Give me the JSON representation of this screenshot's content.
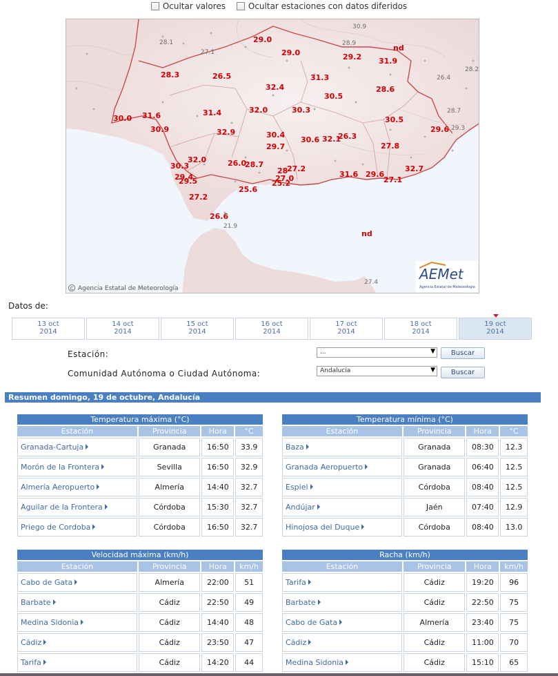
{
  "options": {
    "hide_values": "Ocultar valores",
    "hide_deferred": "Ocultar estaciones con datos diferidos"
  },
  "map": {
    "copyright": "Agencia Estatal de Meteorología",
    "logo_text": "AEMet",
    "logo_sub": "Agencia Estatal de Meteorología",
    "labels_red": [
      "29.0",
      "29.0",
      "29.2",
      "nd",
      "31.9",
      "28.3",
      "26.5",
      "31.3",
      "32.4",
      "30.5",
      "28.6",
      "31.6",
      "31.4",
      "32.0",
      "30.3",
      "30.0",
      "30.9",
      "32.9",
      "30.4",
      "30.6",
      "32.1",
      "26.3",
      "30.5",
      "29.6",
      "29.7",
      "27.8",
      "32.0",
      "26.0",
      "28.7",
      "27.2",
      "30.3",
      "28",
      "29.4",
      "29.5",
      "25.6",
      "25.2",
      "27.0",
      "31.6",
      "29.6",
      "27.1",
      "32.7",
      "27.2",
      "26.6",
      "nd"
    ],
    "labels_grey": [
      "30.9",
      "28.1",
      "27.1",
      "28.9",
      "26.4",
      "28.2",
      "28.7",
      "29.3",
      "21.9",
      "27.4"
    ]
  },
  "datos_label": "Datos de:",
  "dates": [
    {
      "day": "13 oct",
      "year": "2014"
    },
    {
      "day": "14 oct",
      "year": "2014"
    },
    {
      "day": "15 oct",
      "year": "2014"
    },
    {
      "day": "16 oct",
      "year": "2014"
    },
    {
      "day": "17 oct",
      "year": "2014"
    },
    {
      "day": "18 oct",
      "year": "2014"
    },
    {
      "day": "19 oct",
      "year": "2014"
    }
  ],
  "form": {
    "station_label": "Estación:",
    "station_value": "...",
    "ccaa_label": "Comunidad Autónoma o Ciudad Autónoma:",
    "ccaa_value": "Andalucía",
    "search_label": "Buscar"
  },
  "resumen": "Resumen domingo, 19 de octubre, Andalucía",
  "tables": {
    "tmax": {
      "caption": "Temperatura máxima (°C)",
      "headers": [
        "Estación",
        "Provincia",
        "Hora",
        "°C"
      ],
      "rows": [
        [
          "Granada-Cartuja",
          "Granada",
          "16:50",
          "33.9"
        ],
        [
          "Morón de la Frontera",
          "Sevilla",
          "16:50",
          "32.9"
        ],
        [
          "Almería Aeropuerto",
          "Almería",
          "14:40",
          "32.7"
        ],
        [
          "Aguilar de la Frontera",
          "Córdoba",
          "15:30",
          "32.7"
        ],
        [
          "Priego de Cordoba",
          "Córdoba",
          "16:50",
          "32.7"
        ]
      ]
    },
    "tmin": {
      "caption": "Temperatura mínima (°C)",
      "headers": [
        "Estación",
        "Provincia",
        "Hora",
        "°C"
      ],
      "rows": [
        [
          "Baza",
          "Granada",
          "08:30",
          "12.3"
        ],
        [
          "Granada Aeropuerto",
          "Granada",
          "06:40",
          "12.5"
        ],
        [
          "Espiel",
          "Córdoba",
          "08:40",
          "12.5"
        ],
        [
          "Andújar",
          "Jaén",
          "07:40",
          "12.9"
        ],
        [
          "Hinojosa del Duque",
          "Córdoba",
          "08:40",
          "13.0"
        ]
      ]
    },
    "vmax": {
      "caption": "Velocidad máxima (km/h)",
      "headers": [
        "Estación",
        "Provincia",
        "Hora",
        "km/h"
      ],
      "rows": [
        [
          "Cabo de Gata",
          "Almería",
          "22:00",
          "51"
        ],
        [
          "Barbate",
          "Cádiz",
          "22:50",
          "49"
        ],
        [
          "Medina Sidonia",
          "Cádiz",
          "14:40",
          "48"
        ],
        [
          "Cádiz",
          "Cádiz",
          "23:50",
          "47"
        ],
        [
          "Tarifa",
          "Cádiz",
          "14:20",
          "44"
        ]
      ]
    },
    "racha": {
      "caption": "Racha (km/h)",
      "headers": [
        "Estación",
        "Provincia",
        "Hora",
        "km/h"
      ],
      "rows": [
        [
          "Tarifa",
          "Cádiz",
          "19:20",
          "96"
        ],
        [
          "Barbate",
          "Cádiz",
          "22:50",
          "75"
        ],
        [
          "Cabo de Gata",
          "Almería",
          "23:40",
          "75"
        ],
        [
          "Cádiz",
          "Cádiz",
          "11:00",
          "70"
        ],
        [
          "Medina Sidonia",
          "Cádiz",
          "15:10",
          "65"
        ]
      ]
    }
  },
  "colors": {
    "accent": "#4a7fc4",
    "header_light": "#a9c3e6",
    "link": "#3f6aa3",
    "map_value": "#d10000"
  }
}
